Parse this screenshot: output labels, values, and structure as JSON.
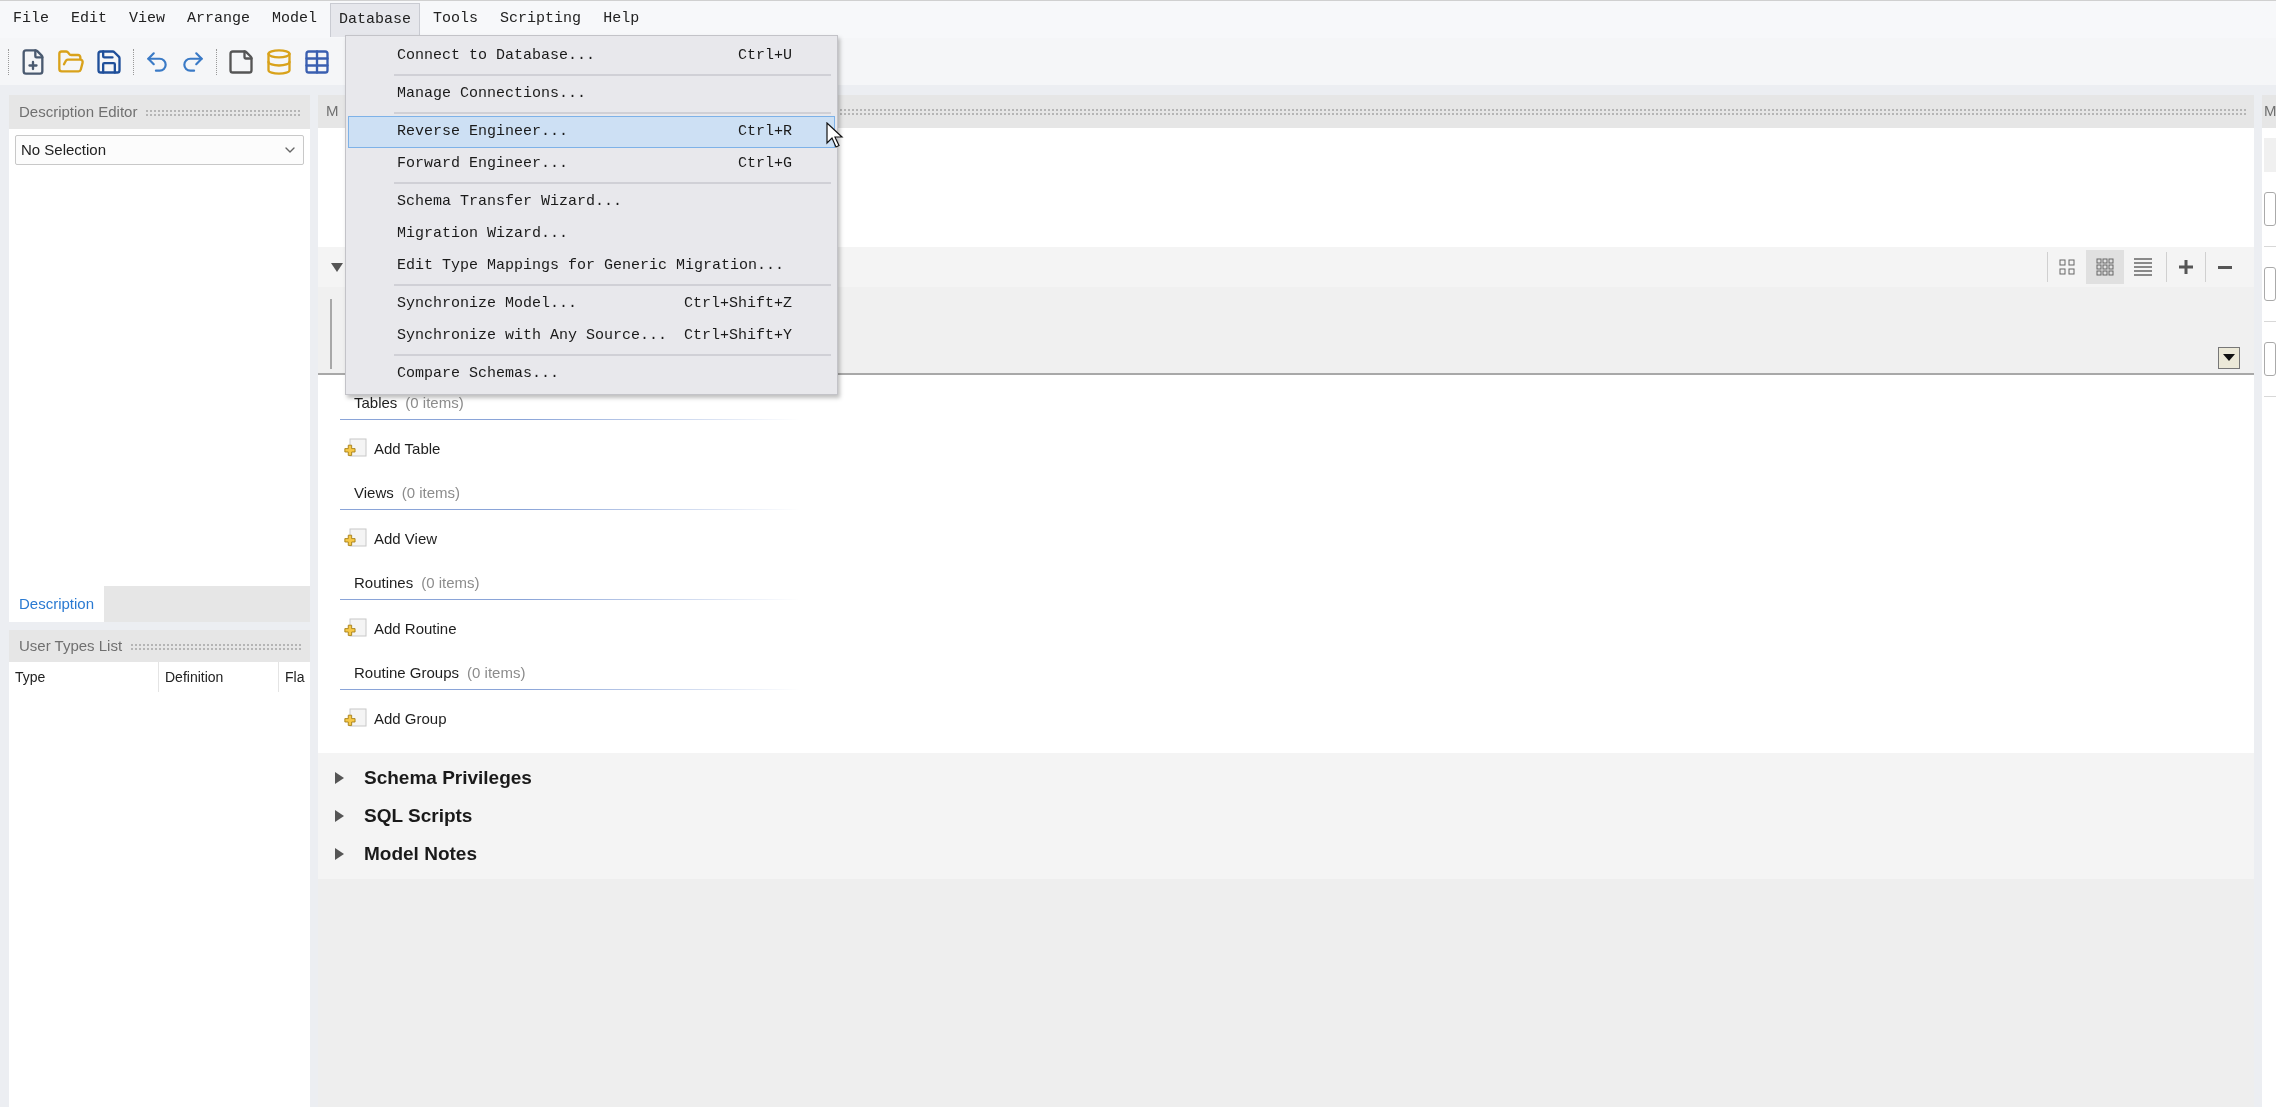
{
  "menu_bar": [
    {
      "label": "File",
      "selected": false
    },
    {
      "label": "Edit",
      "selected": false
    },
    {
      "label": "View",
      "selected": false
    },
    {
      "label": "Arrange",
      "selected": false
    },
    {
      "label": "Model",
      "selected": false
    },
    {
      "label": "Database",
      "selected": true
    },
    {
      "label": "Tools",
      "selected": false
    },
    {
      "label": "Scripting",
      "selected": false
    },
    {
      "label": "Help",
      "selected": false
    }
  ],
  "database_menu": {
    "items": [
      {
        "label": "Connect to Database...",
        "shortcut": "Ctrl+U",
        "selected": false,
        "separator_after": true
      },
      {
        "label": "Manage Connections...",
        "selected": false,
        "separator_after": true
      },
      {
        "label": "Reverse Engineer...",
        "shortcut": "Ctrl+R",
        "selected": true,
        "separator_after": false
      },
      {
        "label": "Forward Engineer...",
        "shortcut": "Ctrl+G",
        "selected": false,
        "separator_after": true
      },
      {
        "label": "Schema Transfer Wizard...",
        "selected": false,
        "separator_after": false
      },
      {
        "label": "Migration Wizard...",
        "selected": false,
        "separator_after": false
      },
      {
        "label": "Edit Type Mappings for Generic Migration...",
        "selected": false,
        "separator_after": true
      },
      {
        "label": "Synchronize Model...",
        "shortcut": "Ctrl+Shift+Z",
        "selected": false,
        "separator_after": false
      },
      {
        "label": "Synchronize with Any Source...",
        "shortcut": "Ctrl+Shift+Y",
        "selected": false,
        "separator_after": true
      },
      {
        "label": "Compare Schemas...",
        "selected": false,
        "separator_after": false
      }
    ]
  },
  "description_editor": {
    "title": "Description Editor",
    "selector": {
      "value": "No Selection"
    },
    "tabs": [
      {
        "label": "Description",
        "selected": true
      }
    ]
  },
  "user_types_list": {
    "title": "User Types List",
    "columns": [
      "Type",
      "Definition",
      "Fla"
    ]
  },
  "main_panel": {
    "title": "M",
    "top_section": {
      "expanded": true
    },
    "view_modes": [
      {
        "kind": "large",
        "selected": false
      },
      {
        "kind": "small",
        "selected": true
      },
      {
        "kind": "list",
        "selected": false
      }
    ],
    "groups": [
      {
        "title": "Tables",
        "count": "(0 items)",
        "add_label": "Add Table"
      },
      {
        "title": "Views",
        "count": "(0 items)",
        "add_label": "Add View"
      },
      {
        "title": "Routines",
        "count": "(0 items)",
        "add_label": "Add Routine"
      },
      {
        "title": "Routine Groups",
        "count": "(0 items)",
        "add_label": "Add Group"
      }
    ],
    "sections": [
      {
        "title": "Schema Privileges",
        "expanded": false
      },
      {
        "title": "SQL Scripts",
        "expanded": false
      },
      {
        "title": "Model Notes",
        "expanded": false
      }
    ]
  },
  "right_panel": {
    "title": "M"
  }
}
